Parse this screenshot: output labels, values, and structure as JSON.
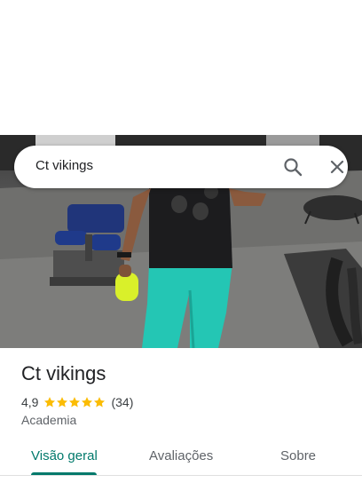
{
  "search": {
    "query": "Ct vikings"
  },
  "place": {
    "name": "Ct vikings",
    "rating": "4,9",
    "stars": 5,
    "review_count": "(34)",
    "category": "Academia"
  },
  "tabs": [
    {
      "label": "Visão geral",
      "active": true
    },
    {
      "label": "Avaliações",
      "active": false
    },
    {
      "label": "Sobre",
      "active": false
    }
  ],
  "colors": {
    "accent": "#00796b",
    "star": "#fbbc04",
    "text_primary": "#202124",
    "text_secondary": "#5f6368"
  },
  "icons": {
    "search": "search-icon",
    "close": "close-icon"
  }
}
